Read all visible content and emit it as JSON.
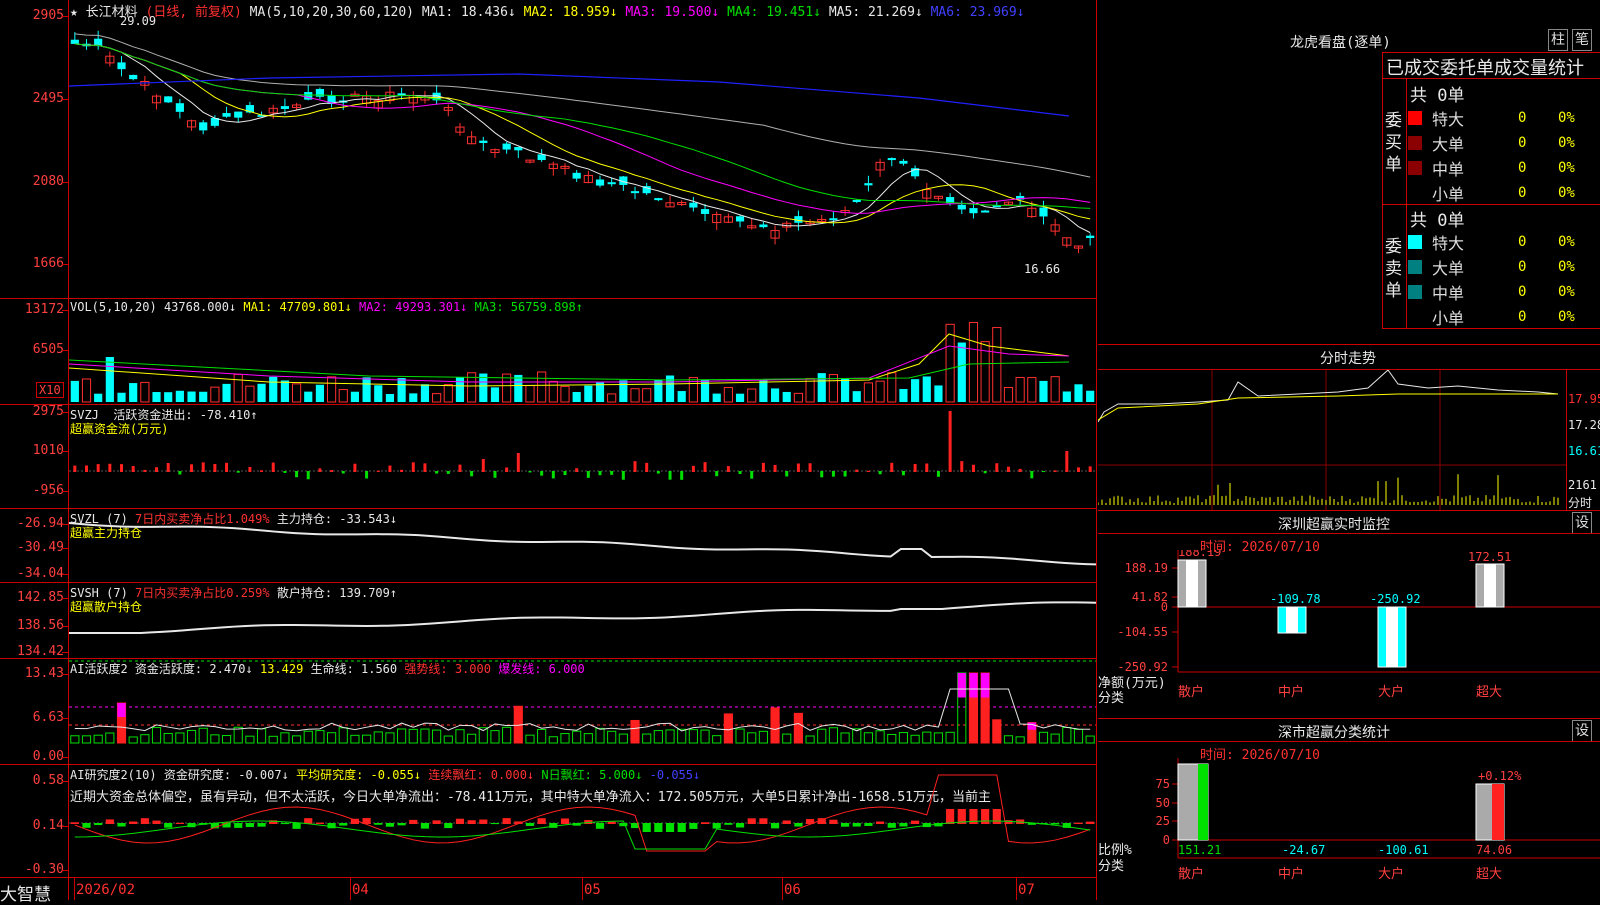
{
  "app": {
    "brand": "大智慧"
  },
  "main_chart": {
    "title_star": "★",
    "stock_name": "长江材料",
    "period": "(日线, 前复权)",
    "ma_label": "MA(5,10,20,30,60,120)",
    "ma": [
      {
        "name": "MA1: 18.436↓",
        "color": "#e8e8e8"
      },
      {
        "name": "MA2: 18.959↓",
        "color": "#ffff00"
      },
      {
        "name": "MA3: 19.500↓",
        "color": "#ff00ff"
      },
      {
        "name": "MA4: 19.451↓",
        "color": "#00e000"
      },
      {
        "name": "MA5: 21.269↓",
        "color": "#e8e8e8"
      },
      {
        "name": "MA6: 23.969↓",
        "color": "#4040ff"
      }
    ],
    "yticks": [
      "2905",
      "2495",
      "2080",
      "1666"
    ],
    "high_label": "29.09",
    "low_label": "16.66"
  },
  "vol": {
    "label": "VOL(5,10,20)",
    "v": "43768.000↓",
    "ma1": "MA1: 47709.801↓",
    "ma2": "MA2: 49293.301↓",
    "ma3": "MA3: 56759.898↑",
    "yticks": [
      "13172",
      "6505"
    ],
    "unit": "X10"
  },
  "svzj": {
    "name": "SVZJ",
    "text": "活跃资金进出: -78.410↑",
    "sub": "超赢资金流(万元)",
    "yticks": [
      "2975",
      "1010",
      "-956"
    ]
  },
  "svzl": {
    "name": "SVZL (7)",
    "text1": "7日内买卖净占比1.049%",
    "text2": "主力持仓: -33.543↓",
    "sub": "超赢主力持仓",
    "yticks": [
      "-26.94",
      "-30.49",
      "-34.04"
    ]
  },
  "svsh": {
    "name": "SVSH (7)",
    "text1": "7日内买卖净占比0.259%",
    "text2": "散户持仓: 139.709↑",
    "sub": "超赢散户持仓",
    "yticks": [
      "142.85",
      "138.56",
      "134.42"
    ]
  },
  "ai_act": {
    "name": "AI活跃度2",
    "t1": "资金活跃度: 2.470↓",
    "t2": "13.429",
    "t3": "生命线: 1.560",
    "t4": "强势线: 3.000",
    "t5": "爆发线: 6.000",
    "yticks": [
      "13.43",
      "6.63",
      "0.00"
    ]
  },
  "ai_res": {
    "name": "AI研究度2(10)",
    "t1": "资金研究度: -0.007↓",
    "t2": "平均研究度: -0.055↓",
    "t3": "连续飘红: 0.000↓",
    "t4": "N日飘红: 5.000↓",
    "t5": "-0.055↓",
    "summary": "近期大资金总体偏空，虽有异动，但不太活跃，今日大单净流出：-78.411万元，其中特大单净流入：172.505万元，大单5日累计净出-1658.51万元，当前主",
    "yticks": [
      "0.58",
      "0.14",
      "-0.30"
    ]
  },
  "xaxis": [
    "2026/02",
    "04",
    "05",
    "06",
    "07"
  ],
  "dragon": {
    "title": "龙虎看盘(逐单)",
    "btn1": "柱",
    "btn2": "笔",
    "subtitle": "已成交委托单成交量统计",
    "buy_side": "委买单",
    "sell_side": "委卖单",
    "buy_total": "共 0单",
    "sell_total": "共 0单",
    "rows": [
      "特大",
      "大单",
      "中单",
      "小单"
    ],
    "zero": "0",
    "pct": "0%"
  },
  "intraday": {
    "title": "分时走势",
    "p1": "17.95",
    "p2": "17.28",
    "p3": "16.61",
    "v": "2161",
    "unit": "分时"
  },
  "sz_monitor": {
    "title": "深圳超赢实时监控",
    "btn": "设",
    "time": "时间: 2026/07/10",
    "yticks": [
      "188.19",
      "41.82",
      "0",
      "-104.55",
      "-250.92"
    ],
    "ylabel1": "净额(万元)",
    "ylabel2": "分类",
    "cats": [
      "散户",
      "中户",
      "大户",
      "超大"
    ],
    "vals": [
      "188.19",
      "-109.78",
      "-250.92",
      "172.51"
    ]
  },
  "sz_class": {
    "title": "深市超赢分类统计",
    "btn": "设",
    "time": "时间: 2026/07/10",
    "yticks": [
      "75",
      "50",
      "25",
      "0"
    ],
    "ylabel1": "比例%",
    "ylabel2": "分类",
    "top_label": "+0.12%",
    "cats": [
      "散户",
      "中户",
      "大户",
      "超大"
    ],
    "vals": [
      "151.21",
      "-24.67",
      "-100.61",
      "74.06"
    ]
  }
}
